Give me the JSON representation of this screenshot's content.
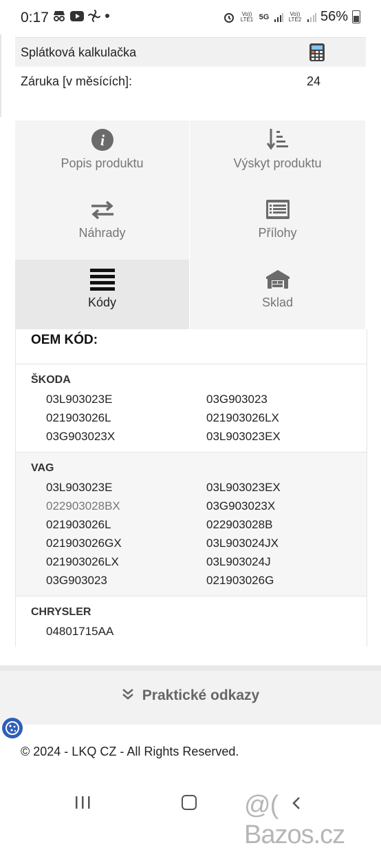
{
  "status": {
    "time": "0:17",
    "battery": "56%",
    "sim1": "Vo)) LTE1",
    "sim2": "Vo)) LTE2",
    "net": "5G"
  },
  "product_info": {
    "installment_calculator_label": "Splátková kalkulačka",
    "warranty_label": "Záruka [v měsících]:",
    "warranty_value": "24"
  },
  "tabs": [
    {
      "label": "Popis produktu",
      "icon": "info-icon"
    },
    {
      "label": "Výskyt produktu",
      "icon": "sort-list-icon"
    },
    {
      "label": "Náhrady",
      "icon": "swap-arrows-icon"
    },
    {
      "label": "Přílohy",
      "icon": "attachment-list-icon"
    },
    {
      "label": "Kódy",
      "icon": "bars-icon",
      "active": true
    },
    {
      "label": "Sklad",
      "icon": "warehouse-icon"
    }
  ],
  "codes": {
    "title": "OEM KÓD:",
    "brands": [
      {
        "name": "ŠKODA",
        "codes": [
          "03L903023E",
          "03G903023",
          "021903026L",
          "021903026LX",
          "03G903023X",
          "03L903023EX"
        ]
      },
      {
        "name": "VAG",
        "codes": [
          "03L903023E",
          "03L903023EX",
          "022903028BX",
          "03G903023X",
          "021903026L",
          "022903028B",
          "021903026GX",
          "03L903024JX",
          "021903026LX",
          "03L903024J",
          "03G903023",
          "021903026G"
        ]
      },
      {
        "name": "CHRYSLER",
        "codes": [
          "04801715AA"
        ]
      }
    ]
  },
  "practical_links_label": "Praktické odkazy",
  "copyright": "© 2024 - LKQ CZ - All Rights Reserved.",
  "watermark": "@( Bazos.cz",
  "colors": {
    "accent_active_tab": "#e8e8e8",
    "icon_gray": "#6b6b6b",
    "cookie_blue": "#2f5fb8"
  }
}
